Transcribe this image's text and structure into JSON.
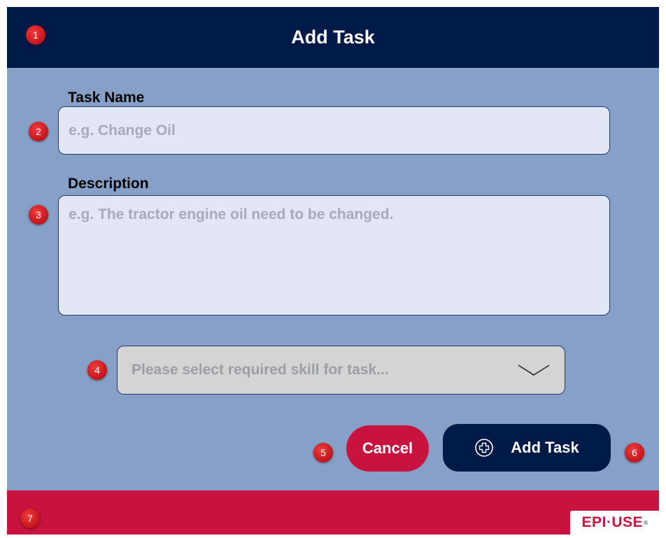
{
  "header": {
    "title": "Add Task"
  },
  "task_name": {
    "label": "Task Name",
    "value": "",
    "placeholder": "e.g. Change Oil"
  },
  "description": {
    "label": "Description",
    "value": "",
    "placeholder": "e.g. The tractor engine oil need to be changed."
  },
  "skill_select": {
    "placeholder": "Please select required skill for task...",
    "icon": "chevron-down-icon"
  },
  "actions": {
    "cancel_label": "Cancel",
    "add_label": "Add Task",
    "add_icon": "plus-circle-icon"
  },
  "footer": {
    "logo_text": "EPI·USE",
    "logo_mark": "®"
  },
  "markers": [
    "1",
    "2",
    "3",
    "4",
    "5",
    "6",
    "7"
  ],
  "colors": {
    "header": "#001a47",
    "body": "#86a0c8",
    "accent": "#c8133e",
    "field": "#e3e6f5",
    "select": "#d4d4d4"
  }
}
